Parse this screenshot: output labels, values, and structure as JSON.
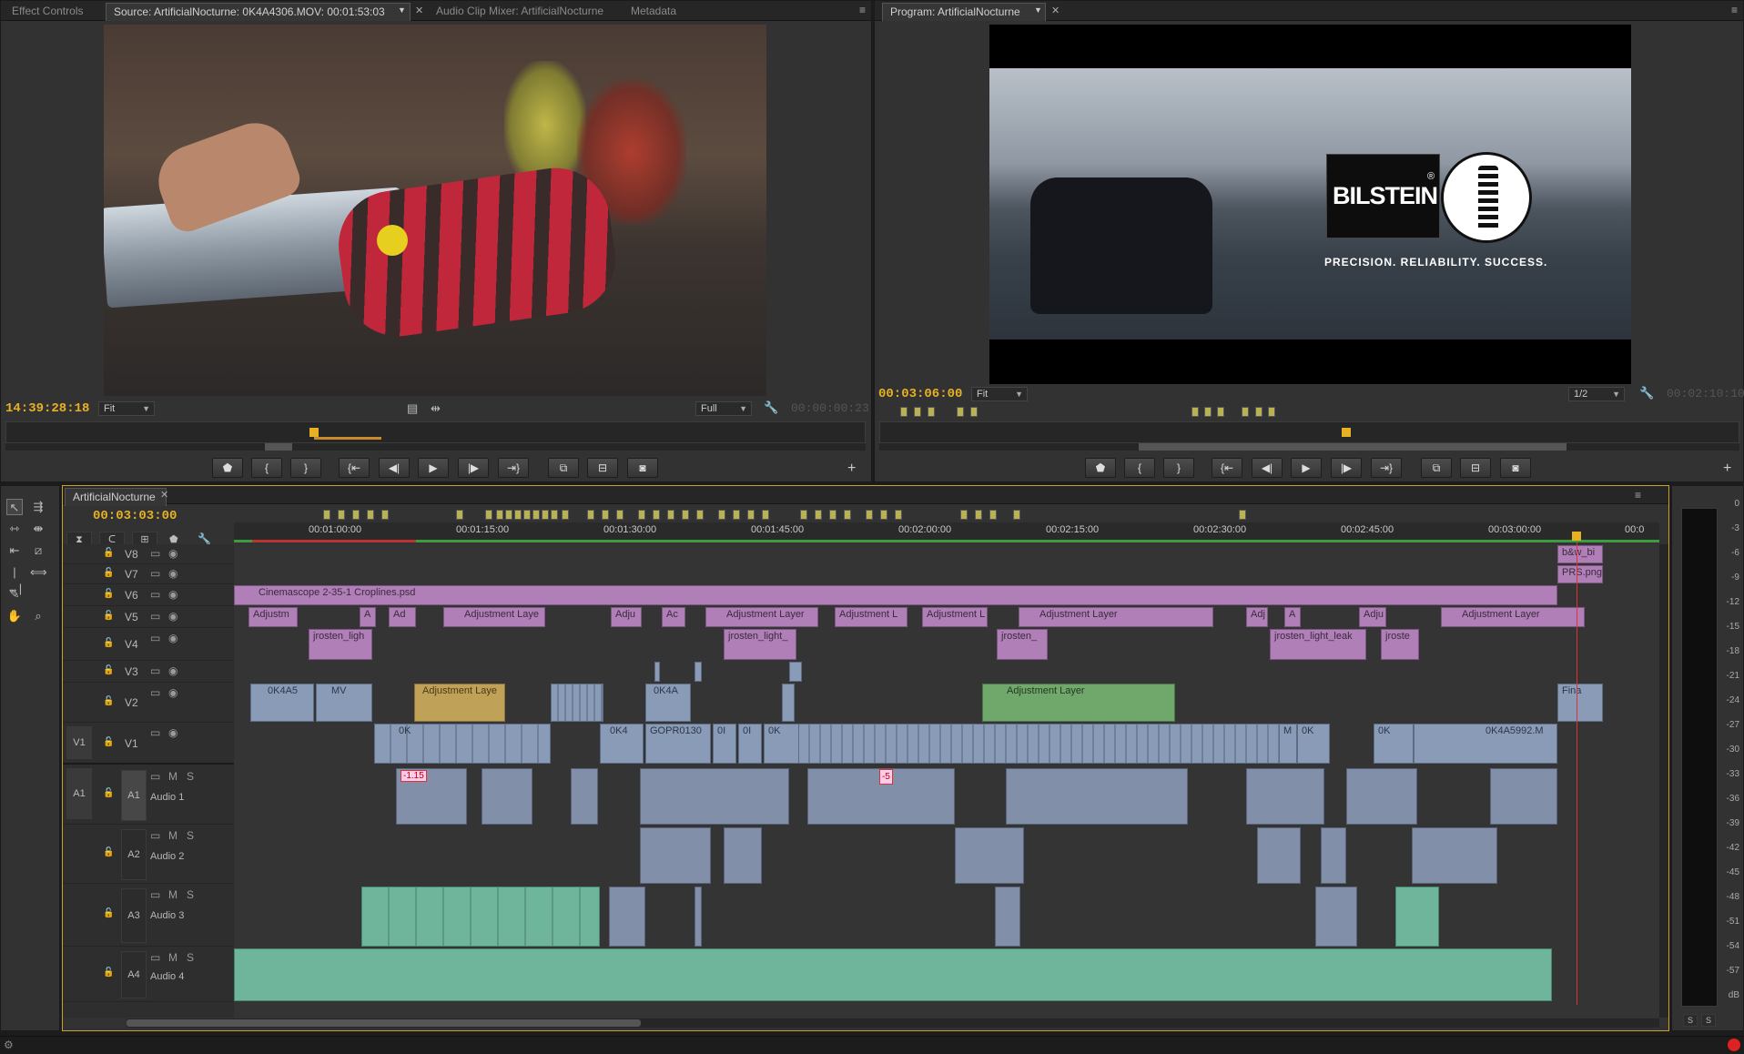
{
  "source_panel": {
    "tabs": [
      "Effect Controls",
      "Source: ArtificialNocturne: 0K4A4306.MOV: 00:01:53:03",
      "Audio Clip Mixer: ArtificialNocturne",
      "Metadata"
    ],
    "timecode": "14:39:28:18",
    "timecode_end": "00:00:00:23",
    "zoom": "Fit",
    "resolution": "Full"
  },
  "program_panel": {
    "tab": "Program: ArtificialNocturne",
    "timecode": "00:03:06:00",
    "timecode_end": "00:02:10:10",
    "zoom": "Fit",
    "resolution": "1/2",
    "overlay": {
      "brand": "BILSTEIN",
      "registered": "®",
      "tagline": "PRECISION. RELIABILITY. SUCCESS."
    }
  },
  "timeline": {
    "tab": "ArtificialNocturne",
    "timecode": "00:03:03:00",
    "ruler": [
      "00:01:00:00",
      "00:01:15:00",
      "00:01:30:00",
      "00:01:45:00",
      "00:02:00:00",
      "00:02:15:00",
      "00:02:30:00",
      "00:02:45:00",
      "00:03:00:00",
      "00:0"
    ],
    "video_tracks": [
      "V8",
      "V7",
      "V6",
      "V5",
      "V4",
      "V3",
      "V2",
      "V1"
    ],
    "audio_tracks": [
      {
        "id": "A1",
        "name": "Audio 1"
      },
      {
        "id": "A2",
        "name": "Audio 2"
      },
      {
        "id": "A3",
        "name": "Audio 3"
      },
      {
        "id": "A4",
        "name": "Audio 4"
      }
    ],
    "source_patch_v": "V1",
    "source_patch_a": "A1",
    "clips": {
      "v8": "b&w_bi",
      "v7": "PRS.png",
      "v6": "Cinemascope 2-35-1 Croplines.psd",
      "v5_1": "Adjustm",
      "v5_2": "A",
      "v5_3": "Ad",
      "v5_4": "Adjustment Laye",
      "v5_5": "Adju",
      "v5_6": "Ac",
      "v5_7": "Adjustment Layer",
      "v5_8": "Adjustment L",
      "v5_9": "Adjustment L",
      "v5_10": "Adjustment Layer",
      "v5_11": "Adj",
      "v5_12": "A",
      "v5_13": "Adju",
      "v5_14": "Adjustment Layer",
      "v4_1": "jrosten_ligh",
      "v4_2": "jrosten_light_",
      "v4_3": "jrosten_",
      "v4_4": "jrosten_light_leak",
      "v4_5": "jroste",
      "v2_1": "0K4A5",
      "v2_2": "MV",
      "v2_3": "Adjustment Laye",
      "v2_4": "0K4A",
      "v2_5": "Adjustment Layer",
      "v2_6": "Fina",
      "v1_1": "0K",
      "v1_2": "0K4",
      "v1_3": "GOPR0130",
      "v1_4": "0I",
      "v1_5": "0I",
      "v1_6": "0K",
      "v1_7": "M",
      "v1_8": "0K",
      "v1_9": "0K",
      "v1_10": "0K4A5992.M",
      "a1_gain": "-1.15",
      "a1_gain2": "-5"
    }
  },
  "meter": {
    "labels": [
      "0",
      "-3",
      "-6",
      "-9",
      "-12",
      "-15",
      "-18",
      "-21",
      "-24",
      "-27",
      "-30",
      "-33",
      "-36",
      "-39",
      "-42",
      "-45",
      "-48",
      "-51",
      "-54",
      "-57",
      "dB"
    ],
    "solo": "S"
  },
  "track_buttons": {
    "mute": "M",
    "solo": "S"
  },
  "icons": [
    "marker-icon",
    "in-point-icon",
    "out-point-icon",
    "go-to-in-icon",
    "step-back-icon",
    "play-icon",
    "step-forward-icon",
    "go-to-out-icon",
    "insert-icon",
    "overwrite-icon",
    "camera-icon",
    "wrench-icon",
    "plus-icon",
    "lock-icon",
    "toggle-output-icon",
    "eye-icon"
  ]
}
